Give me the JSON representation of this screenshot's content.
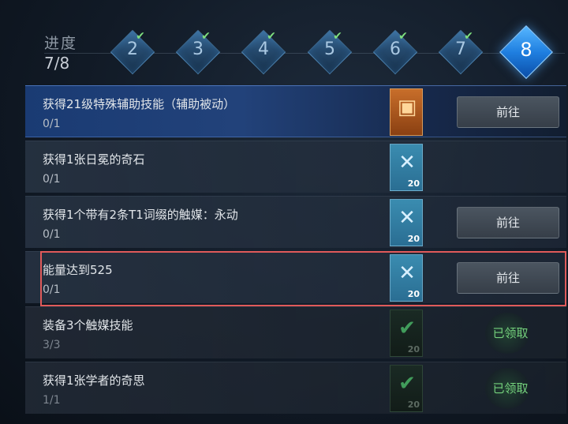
{
  "progress": {
    "label": "进度",
    "count": "7/8",
    "steps": [
      {
        "num": "2",
        "completed": true
      },
      {
        "num": "3",
        "completed": true
      },
      {
        "num": "4",
        "completed": true
      },
      {
        "num": "5",
        "completed": true
      },
      {
        "num": "6",
        "completed": true
      },
      {
        "num": "7",
        "completed": true
      },
      {
        "num": "8",
        "completed": false,
        "current": true
      }
    ],
    "check_glyph": "✔"
  },
  "tasks": [
    {
      "title": "获得21级特殊辅助技能（辅助被动）",
      "count": "0/1",
      "reward_icon": "treasure-chest-icon",
      "reward_glyph": "▣",
      "reward_qty": "",
      "action": "前往"
    },
    {
      "title": "获得1张日冕的奇石",
      "count": "0/1",
      "reward_icon": "crossed-swords-icon",
      "reward_glyph": "✕",
      "reward_qty": "20",
      "action": ""
    },
    {
      "title": "获得1个带有2条T1词缀的触媒：永动",
      "count": "0/1",
      "reward_icon": "crossed-swords-icon",
      "reward_glyph": "✕",
      "reward_qty": "20",
      "action": "前往"
    },
    {
      "title": "能量达到525",
      "count": "0/1",
      "reward_icon": "crossed-swords-icon",
      "reward_glyph": "✕",
      "reward_qty": "20",
      "action": "前往"
    },
    {
      "title": "装备3个触媒技能",
      "count": "3/3",
      "reward_icon": "claimed-check-icon",
      "reward_glyph": "✔",
      "reward_qty": "20",
      "status": "已领取"
    },
    {
      "title": "获得1张学者的奇思",
      "count": "1/1",
      "reward_icon": "claimed-check-icon",
      "reward_glyph": "✔",
      "reward_qty": "20",
      "status": "已领取"
    }
  ],
  "colors": {
    "active_row": "#1a3b73",
    "current_step": "#1f7fe0",
    "highlight_border": "#e05a5a",
    "claimed_text": "#74d07c"
  }
}
